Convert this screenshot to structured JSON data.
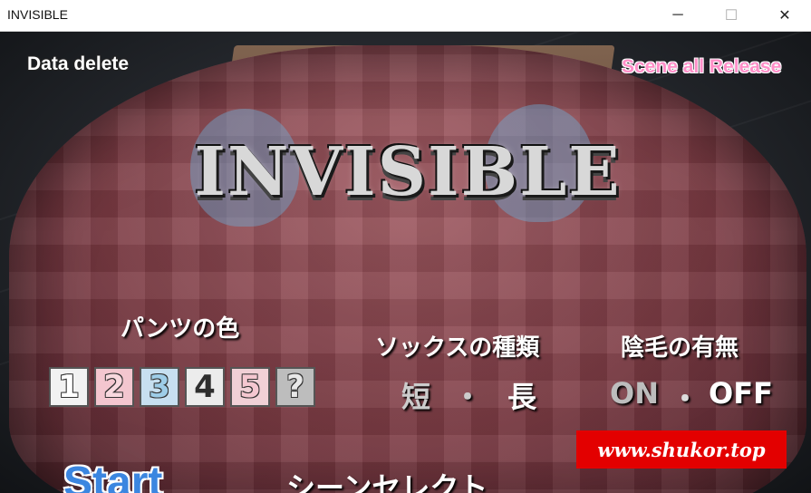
{
  "window": {
    "title": "INVISIBLE",
    "minimize_glyph": "─",
    "maximize_glyph": "☐",
    "close_glyph": "✕"
  },
  "menu": {
    "data_delete": "Data delete",
    "scene_all_release": "Scene all Release",
    "start": "Start",
    "scene_select": "シーンセレクト"
  },
  "logo": {
    "text": "INVISIBLE"
  },
  "options": {
    "pants_color": {
      "label": "パンツの色",
      "choices": [
        "1",
        "2",
        "3",
        "4",
        "5",
        "?"
      ]
    },
    "socks_type": {
      "label": "ソックスの種類",
      "short": "短",
      "separator": "・",
      "long": "長"
    },
    "pubic_hair": {
      "label": "陰毛の有無",
      "on": "ON",
      "separator": "・",
      "off": "OFF"
    }
  },
  "watermark": {
    "text": "www.shukor.top"
  },
  "colors": {
    "start_blue": "#3b86e0",
    "scene_pink": "#ff8fc8",
    "watermark_red": "#e30000"
  }
}
